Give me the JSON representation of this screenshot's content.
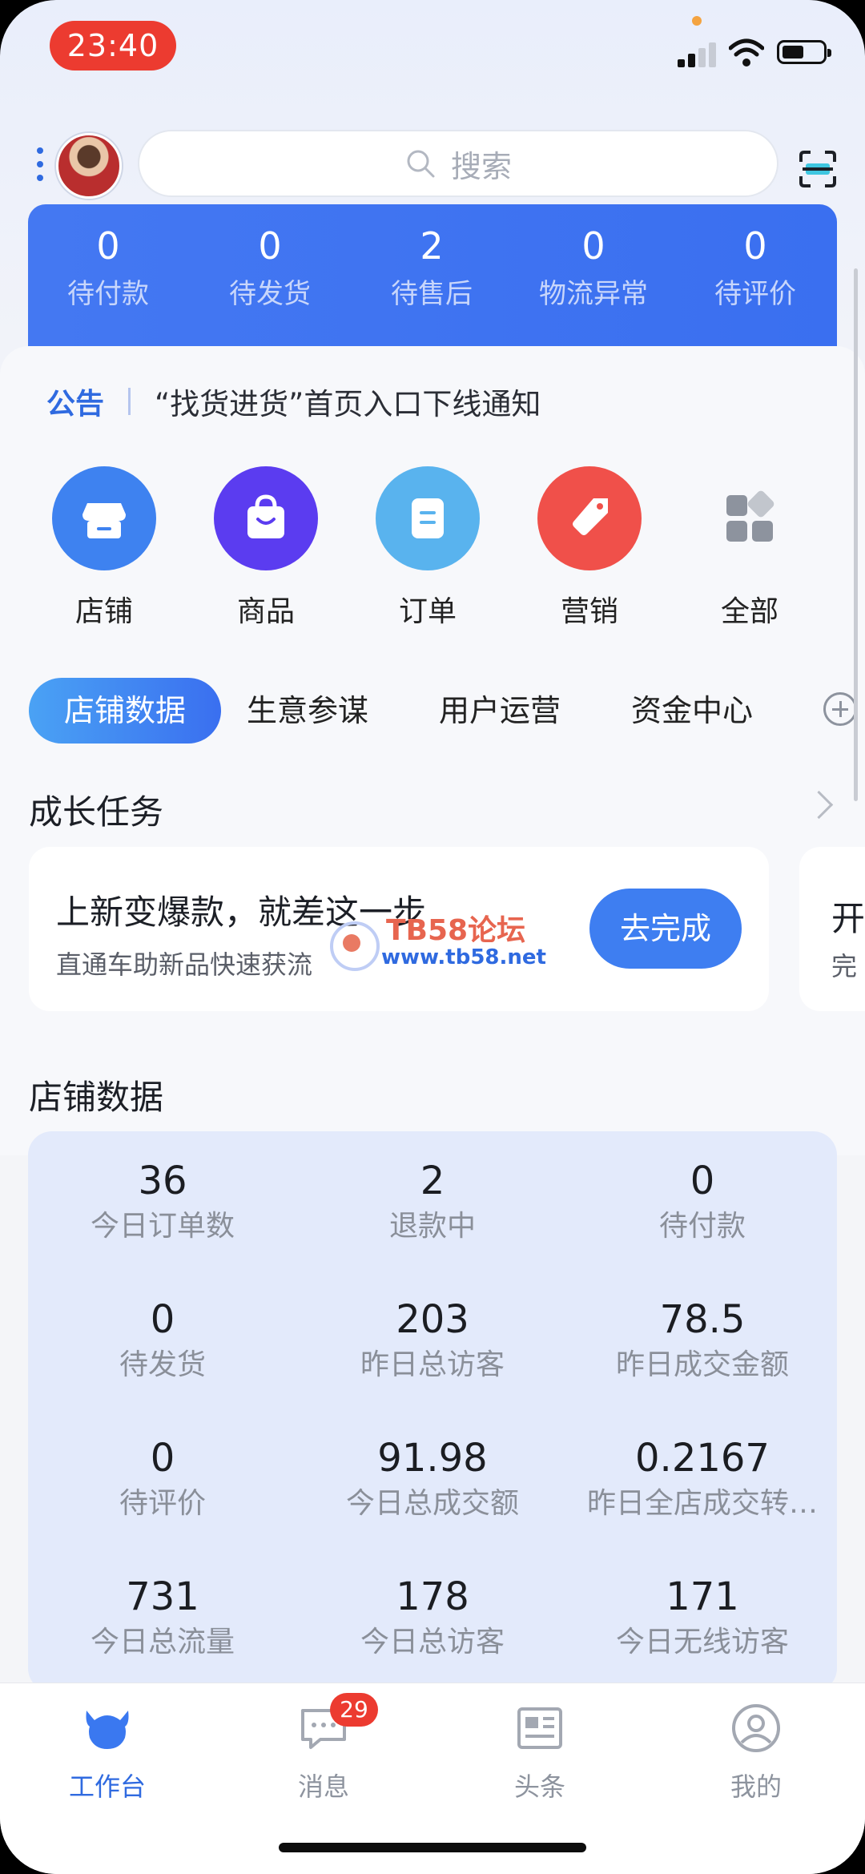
{
  "status_bar": {
    "time": "23:40"
  },
  "header": {
    "search_placeholder": "搜索"
  },
  "order_summary": [
    {
      "value": "0",
      "label": "待付款"
    },
    {
      "value": "0",
      "label": "待发货"
    },
    {
      "value": "2",
      "label": "待售后"
    },
    {
      "value": "0",
      "label": "物流异常"
    },
    {
      "value": "0",
      "label": "待评价"
    }
  ],
  "notice": {
    "tag": "公告",
    "text": "“找货进货”首页入口下线通知"
  },
  "functions": [
    {
      "label": "店铺",
      "icon": "store-icon"
    },
    {
      "label": "商品",
      "icon": "shopping-bag-icon"
    },
    {
      "label": "订单",
      "icon": "order-doc-icon"
    },
    {
      "label": "营销",
      "icon": "price-tag-icon"
    },
    {
      "label": "全部",
      "icon": "grid-apps-icon"
    }
  ],
  "tabs": [
    "店铺数据",
    "生意参谋",
    "用户运营",
    "资金中心"
  ],
  "growth": {
    "title": "成长任务",
    "task_title": "上新变爆款，就差这一步",
    "task_subtitle": "直通车助新品快速获流",
    "task_button": "去完成",
    "peek_title": "开",
    "peek_sub": "完"
  },
  "watermark": {
    "title": "TB58论坛",
    "url": "www.tb58.net"
  },
  "store_data": {
    "title": "店铺数据",
    "stats": [
      {
        "value": "36",
        "label": "今日订单数"
      },
      {
        "value": "2",
        "label": "退款中"
      },
      {
        "value": "0",
        "label": "待付款"
      },
      {
        "value": "0",
        "label": "待发货"
      },
      {
        "value": "203",
        "label": "昨日总访客"
      },
      {
        "value": "78.5",
        "label": "昨日成交金额"
      },
      {
        "value": "0",
        "label": "待评价"
      },
      {
        "value": "91.98",
        "label": "今日总成交额"
      },
      {
        "value": "0.2167",
        "label": "昨日全店成交转…"
      },
      {
        "value": "731",
        "label": "今日总流量"
      },
      {
        "value": "178",
        "label": "今日总访客"
      },
      {
        "value": "171",
        "label": "今日无线访客"
      }
    ]
  },
  "tabbar": {
    "items": [
      {
        "label": "工作台",
        "icon": "workbench-cow-icon"
      },
      {
        "label": "消息",
        "icon": "message-bubble-icon",
        "badge": "29"
      },
      {
        "label": "头条",
        "icon": "news-icon"
      },
      {
        "label": "我的",
        "icon": "profile-icon"
      }
    ]
  },
  "colors": {
    "accent": "#3a6ff0",
    "badge": "#ec3b30",
    "stats_bg": "#e3eafb"
  }
}
